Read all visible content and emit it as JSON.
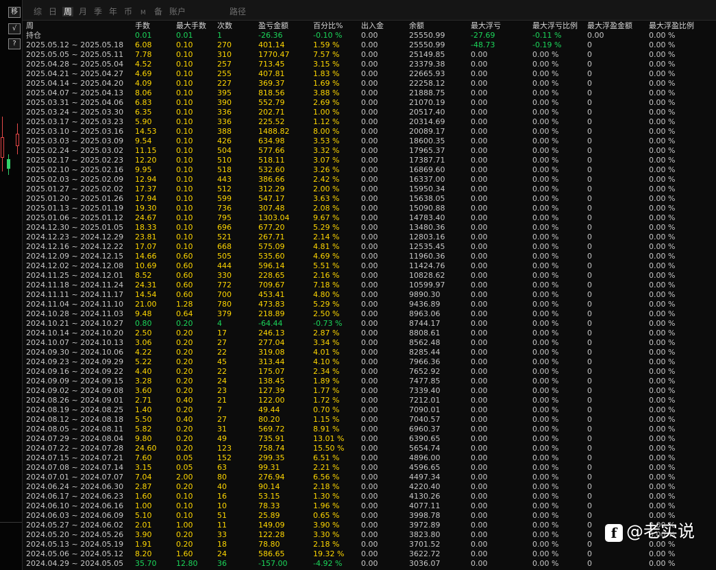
{
  "toolbar": {
    "buttons": [
      {
        "name": "shift-button",
        "glyph": "移"
      },
      {
        "name": "line-tool-button",
        "glyph": "√"
      },
      {
        "name": "help-button",
        "glyph": "?"
      }
    ]
  },
  "tabs": [
    {
      "label": "综",
      "active": false
    },
    {
      "label": "日",
      "active": false
    },
    {
      "label": "周",
      "active": true
    },
    {
      "label": "月",
      "active": false
    },
    {
      "label": "季",
      "active": false
    },
    {
      "label": "年",
      "active": false
    },
    {
      "label": "币",
      "active": false
    },
    {
      "label": "M",
      "active": false
    },
    {
      "label": "备",
      "active": false
    },
    {
      "label": "账户",
      "active": false
    },
    {
      "label": "路径",
      "active": false
    }
  ],
  "headers": [
    "周",
    "手数",
    "最大手数",
    "次数",
    "盈亏金额",
    "百分比%",
    "出入金",
    "余额",
    "最大浮亏",
    "最大浮亏比例",
    "最大浮盈金额",
    "最大浮盈比例"
  ],
  "holding_row": {
    "label": "持仓",
    "lots": "0.01",
    "max_lots": "0.01",
    "count": "1",
    "pnl": "-26.36",
    "pct": "-0.10 %",
    "io": "0.00",
    "balance": "25550.99",
    "max_float_loss": "-27.69",
    "max_float_loss_pct": "-0.11 %",
    "max_float_gain": "0.00",
    "max_float_gain_pct": "0.00 %"
  },
  "rows": [
    [
      "2025.05.12 ~ 2025.05.18",
      "6.08",
      "0.10",
      "270",
      "401.14",
      "1.59 %",
      "0.00",
      "25550.99",
      "-48.73",
      "-0.19 %",
      "0",
      "0.00 %"
    ],
    [
      "2025.05.05 ~ 2025.05.11",
      "7.78",
      "0.10",
      "310",
      "1770.47",
      "7.57 %",
      "0.00",
      "25149.85",
      "0.00",
      "0.00 %",
      "0",
      "0.00 %"
    ],
    [
      "2025.04.28 ~ 2025.05.04",
      "4.52",
      "0.10",
      "257",
      "713.45",
      "3.15 %",
      "0.00",
      "23379.38",
      "0.00",
      "0.00 %",
      "0",
      "0.00 %"
    ],
    [
      "2025.04.21 ~ 2025.04.27",
      "4.69",
      "0.10",
      "255",
      "407.81",
      "1.83 %",
      "0.00",
      "22665.93",
      "0.00",
      "0.00 %",
      "0",
      "0.00 %"
    ],
    [
      "2025.04.14 ~ 2025.04.20",
      "4.09",
      "0.10",
      "227",
      "369.37",
      "1.69 %",
      "0.00",
      "22258.12",
      "0.00",
      "0.00 %",
      "0",
      "0.00 %"
    ],
    [
      "2025.04.07 ~ 2025.04.13",
      "8.06",
      "0.10",
      "395",
      "818.56",
      "3.88 %",
      "0.00",
      "21888.75",
      "0.00",
      "0.00 %",
      "0",
      "0.00 %"
    ],
    [
      "2025.03.31 ~ 2025.04.06",
      "6.83",
      "0.10",
      "390",
      "552.79",
      "2.69 %",
      "0.00",
      "21070.19",
      "0.00",
      "0.00 %",
      "0",
      "0.00 %"
    ],
    [
      "2025.03.24 ~ 2025.03.30",
      "6.35",
      "0.10",
      "336",
      "202.71",
      "1.00 %",
      "0.00",
      "20517.40",
      "0.00",
      "0.00 %",
      "0",
      "0.00 %"
    ],
    [
      "2025.03.17 ~ 2025.03.23",
      "5.90",
      "0.10",
      "336",
      "225.52",
      "1.12 %",
      "0.00",
      "20314.69",
      "0.00",
      "0.00 %",
      "0",
      "0.00 %"
    ],
    [
      "2025.03.10 ~ 2025.03.16",
      "14.53",
      "0.10",
      "388",
      "1488.82",
      "8.00 %",
      "0.00",
      "20089.17",
      "0.00",
      "0.00 %",
      "0",
      "0.00 %"
    ],
    [
      "2025.03.03 ~ 2025.03.09",
      "9.54",
      "0.10",
      "426",
      "634.98",
      "3.53 %",
      "0.00",
      "18600.35",
      "0.00",
      "0.00 %",
      "0",
      "0.00 %"
    ],
    [
      "2025.02.24 ~ 2025.03.02",
      "11.15",
      "0.10",
      "504",
      "577.66",
      "3.32 %",
      "0.00",
      "17965.37",
      "0.00",
      "0.00 %",
      "0",
      "0.00 %"
    ],
    [
      "2025.02.17 ~ 2025.02.23",
      "12.20",
      "0.10",
      "510",
      "518.11",
      "3.07 %",
      "0.00",
      "17387.71",
      "0.00",
      "0.00 %",
      "0",
      "0.00 %"
    ],
    [
      "2025.02.10 ~ 2025.02.16",
      "9.95",
      "0.10",
      "518",
      "532.60",
      "3.26 %",
      "0.00",
      "16869.60",
      "0.00",
      "0.00 %",
      "0",
      "0.00 %"
    ],
    [
      "2025.02.03 ~ 2025.02.09",
      "12.94",
      "0.10",
      "443",
      "386.66",
      "2.42 %",
      "0.00",
      "16337.00",
      "0.00",
      "0.00 %",
      "0",
      "0.00 %"
    ],
    [
      "2025.01.27 ~ 2025.02.02",
      "17.37",
      "0.10",
      "512",
      "312.29",
      "2.00 %",
      "0.00",
      "15950.34",
      "0.00",
      "0.00 %",
      "0",
      "0.00 %"
    ],
    [
      "2025.01.20 ~ 2025.01.26",
      "17.94",
      "0.10",
      "599",
      "547.17",
      "3.63 %",
      "0.00",
      "15638.05",
      "0.00",
      "0.00 %",
      "0",
      "0.00 %"
    ],
    [
      "2025.01.13 ~ 2025.01.19",
      "19.30",
      "0.10",
      "736",
      "307.48",
      "2.08 %",
      "0.00",
      "15090.88",
      "0.00",
      "0.00 %",
      "0",
      "0.00 %"
    ],
    [
      "2025.01.06 ~ 2025.01.12",
      "24.67",
      "0.10",
      "795",
      "1303.04",
      "9.67 %",
      "0.00",
      "14783.40",
      "0.00",
      "0.00 %",
      "0",
      "0.00 %"
    ],
    [
      "2024.12.30 ~ 2025.01.05",
      "18.33",
      "0.10",
      "696",
      "677.20",
      "5.29 %",
      "0.00",
      "13480.36",
      "0.00",
      "0.00 %",
      "0",
      "0.00 %"
    ],
    [
      "2024.12.23 ~ 2024.12.29",
      "23.81",
      "0.10",
      "521",
      "267.71",
      "2.14 %",
      "0.00",
      "12803.16",
      "0.00",
      "0.00 %",
      "0",
      "0.00 %"
    ],
    [
      "2024.12.16 ~ 2024.12.22",
      "17.07",
      "0.10",
      "668",
      "575.09",
      "4.81 %",
      "0.00",
      "12535.45",
      "0.00",
      "0.00 %",
      "0",
      "0.00 %"
    ],
    [
      "2024.12.09 ~ 2024.12.15",
      "14.66",
      "0.60",
      "505",
      "535.60",
      "4.69 %",
      "0.00",
      "11960.36",
      "0.00",
      "0.00 %",
      "0",
      "0.00 %"
    ],
    [
      "2024.12.02 ~ 2024.12.08",
      "10.69",
      "0.60",
      "444",
      "596.14",
      "5.51 %",
      "0.00",
      "11424.76",
      "0.00",
      "0.00 %",
      "0",
      "0.00 %"
    ],
    [
      "2024.11.25 ~ 2024.12.01",
      "8.52",
      "0.60",
      "330",
      "228.65",
      "2.16 %",
      "0.00",
      "10828.62",
      "0.00",
      "0.00 %",
      "0",
      "0.00 %"
    ],
    [
      "2024.11.18 ~ 2024.11.24",
      "24.31",
      "0.60",
      "772",
      "709.67",
      "7.18 %",
      "0.00",
      "10599.97",
      "0.00",
      "0.00 %",
      "0",
      "0.00 %"
    ],
    [
      "2024.11.11 ~ 2024.11.17",
      "14.54",
      "0.60",
      "700",
      "453.41",
      "4.80 %",
      "0.00",
      "9890.30",
      "0.00",
      "0.00 %",
      "0",
      "0.00 %"
    ],
    [
      "2024.11.04 ~ 2024.11.10",
      "21.00",
      "1.28",
      "780",
      "473.83",
      "5.29 %",
      "0.00",
      "9436.89",
      "0.00",
      "0.00 %",
      "0",
      "0.00 %"
    ],
    [
      "2024.10.28 ~ 2024.11.03",
      "9.48",
      "0.64",
      "379",
      "218.89",
      "2.50 %",
      "0.00",
      "8963.06",
      "0.00",
      "0.00 %",
      "0",
      "0.00 %"
    ],
    [
      "2024.10.21 ~ 2024.10.27",
      "0.80",
      "0.20",
      "4",
      "-64.44",
      "-0.73 %",
      "0.00",
      "8744.17",
      "0.00",
      "0.00 %",
      "0",
      "0.00 %"
    ],
    [
      "2024.10.14 ~ 2024.10.20",
      "2.50",
      "0.20",
      "17",
      "246.13",
      "2.87 %",
      "0.00",
      "8808.61",
      "0.00",
      "0.00 %",
      "0",
      "0.00 %"
    ],
    [
      "2024.10.07 ~ 2024.10.13",
      "3.06",
      "0.20",
      "27",
      "277.04",
      "3.34 %",
      "0.00",
      "8562.48",
      "0.00",
      "0.00 %",
      "0",
      "0.00 %"
    ],
    [
      "2024.09.30 ~ 2024.10.06",
      "4.22",
      "0.20",
      "22",
      "319.08",
      "4.01 %",
      "0.00",
      "8285.44",
      "0.00",
      "0.00 %",
      "0",
      "0.00 %"
    ],
    [
      "2024.09.23 ~ 2024.09.29",
      "5.22",
      "0.20",
      "45",
      "313.44",
      "4.10 %",
      "0.00",
      "7966.36",
      "0.00",
      "0.00 %",
      "0",
      "0.00 %"
    ],
    [
      "2024.09.16 ~ 2024.09.22",
      "4.40",
      "0.20",
      "22",
      "175.07",
      "2.34 %",
      "0.00",
      "7652.92",
      "0.00",
      "0.00 %",
      "0",
      "0.00 %"
    ],
    [
      "2024.09.09 ~ 2024.09.15",
      "3.28",
      "0.20",
      "24",
      "138.45",
      "1.89 %",
      "0.00",
      "7477.85",
      "0.00",
      "0.00 %",
      "0",
      "0.00 %"
    ],
    [
      "2024.09.02 ~ 2024.09.08",
      "3.60",
      "0.20",
      "23",
      "127.39",
      "1.77 %",
      "0.00",
      "7339.40",
      "0.00",
      "0.00 %",
      "0",
      "0.00 %"
    ],
    [
      "2024.08.26 ~ 2024.09.01",
      "2.71",
      "0.40",
      "21",
      "122.00",
      "1.72 %",
      "0.00",
      "7212.01",
      "0.00",
      "0.00 %",
      "0",
      "0.00 %"
    ],
    [
      "2024.08.19 ~ 2024.08.25",
      "1.40",
      "0.20",
      "7",
      "49.44",
      "0.70 %",
      "0.00",
      "7090.01",
      "0.00",
      "0.00 %",
      "0",
      "0.00 %"
    ],
    [
      "2024.08.12 ~ 2024.08.18",
      "5.50",
      "0.40",
      "27",
      "80.20",
      "1.15 %",
      "0.00",
      "7040.57",
      "0.00",
      "0.00 %",
      "0",
      "0.00 %"
    ],
    [
      "2024.08.05 ~ 2024.08.11",
      "5.82",
      "0.20",
      "31",
      "569.72",
      "8.91 %",
      "0.00",
      "6960.37",
      "0.00",
      "0.00 %",
      "0",
      "0.00 %"
    ],
    [
      "2024.07.29 ~ 2024.08.04",
      "9.80",
      "0.20",
      "49",
      "735.91",
      "13.01 %",
      "0.00",
      "6390.65",
      "0.00",
      "0.00 %",
      "0",
      "0.00 %"
    ],
    [
      "2024.07.22 ~ 2024.07.28",
      "24.60",
      "0.20",
      "123",
      "758.74",
      "15.50 %",
      "0.00",
      "5654.74",
      "0.00",
      "0.00 %",
      "0",
      "0.00 %"
    ],
    [
      "2024.07.15 ~ 2024.07.21",
      "7.60",
      "0.05",
      "152",
      "299.35",
      "6.51 %",
      "0.00",
      "4896.00",
      "0.00",
      "0.00 %",
      "0",
      "0.00 %"
    ],
    [
      "2024.07.08 ~ 2024.07.14",
      "3.15",
      "0.05",
      "63",
      "99.31",
      "2.21 %",
      "0.00",
      "4596.65",
      "0.00",
      "0.00 %",
      "0",
      "0.00 %"
    ],
    [
      "2024.07.01 ~ 2024.07.07",
      "7.04",
      "2.00",
      "80",
      "276.94",
      "6.56 %",
      "0.00",
      "4497.34",
      "0.00",
      "0.00 %",
      "0",
      "0.00 %"
    ],
    [
      "2024.06.24 ~ 2024.06.30",
      "2.87",
      "0.20",
      "40",
      "90.14",
      "2.18 %",
      "0.00",
      "4220.40",
      "0.00",
      "0.00 %",
      "0",
      "0.00 %"
    ],
    [
      "2024.06.17 ~ 2024.06.23",
      "1.60",
      "0.10",
      "16",
      "53.15",
      "1.30 %",
      "0.00",
      "4130.26",
      "0.00",
      "0.00 %",
      "0",
      "0.00 %"
    ],
    [
      "2024.06.10 ~ 2024.06.16",
      "1.00",
      "0.10",
      "10",
      "78.33",
      "1.96 %",
      "0.00",
      "4077.11",
      "0.00",
      "0.00 %",
      "0",
      "0.00 %"
    ],
    [
      "2024.06.03 ~ 2024.06.09",
      "5.10",
      "0.10",
      "51",
      "25.89",
      "0.65 %",
      "0.00",
      "3998.78",
      "0.00",
      "0.00 %",
      "0",
      "0.00 %"
    ],
    [
      "2024.05.27 ~ 2024.06.02",
      "2.01",
      "1.00",
      "11",
      "149.09",
      "3.90 %",
      "0.00",
      "3972.89",
      "0.00",
      "0.00 %",
      "0",
      "0.00 %"
    ],
    [
      "2024.05.20 ~ 2024.05.26",
      "3.90",
      "0.20",
      "33",
      "122.28",
      "3.30 %",
      "0.00",
      "3823.80",
      "0.00",
      "0.00 %",
      "0",
      "0.00 %"
    ],
    [
      "2024.05.13 ~ 2024.05.19",
      "1.91",
      "0.20",
      "18",
      "78.80",
      "2.18 %",
      "0.00",
      "3701.52",
      "0.00",
      "0.00 %",
      "0",
      "0.00 %"
    ],
    [
      "2024.05.06 ~ 2024.05.12",
      "8.20",
      "1.60",
      "24",
      "586.65",
      "19.32 %",
      "0.00",
      "3622.72",
      "0.00",
      "0.00 %",
      "0",
      "0.00 %"
    ],
    [
      "2024.04.29 ~ 2024.05.05",
      "35.70",
      "12.80",
      "36",
      "-157.00",
      "-4.92 %",
      "0.00",
      "3036.07",
      "0.00",
      "0.00 %",
      "0",
      "0.00 %"
    ]
  ],
  "colors": {
    "positive": "#ffd700",
    "negative": "#1bd65a",
    "neutral": "#c8c8c8",
    "header": "#d6d6d6",
    "loss_red": "#ff3a3a"
  },
  "watermark": {
    "logo_glyph": "f",
    "text": "@老实说"
  }
}
